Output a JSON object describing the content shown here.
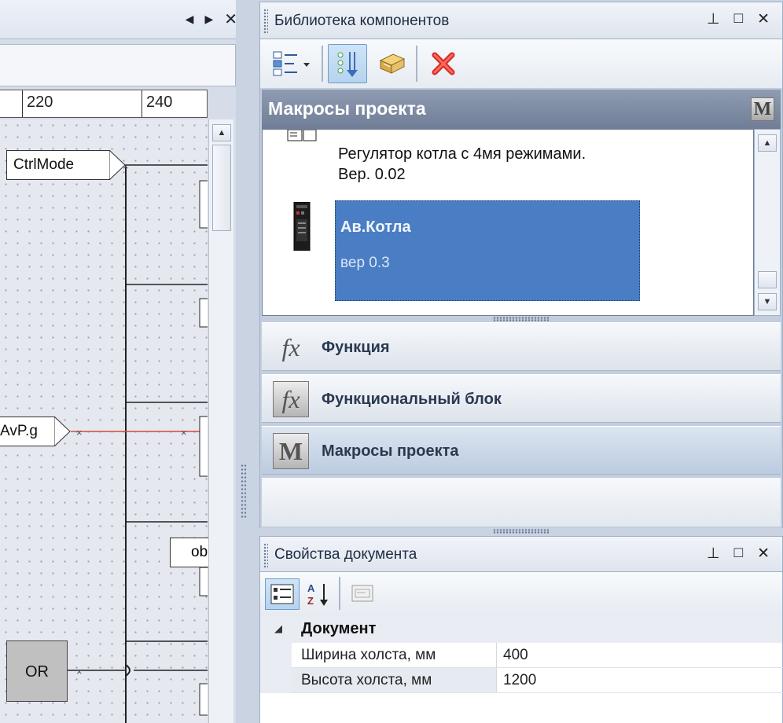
{
  "editor": {
    "tab_nav": {
      "prev": "◀",
      "next": "▶",
      "close": "✕"
    },
    "ruler": {
      "labels": [
        "220",
        "240"
      ]
    },
    "scroll_up": "▲",
    "labels": {
      "ctrl_mode": "CtrlMode",
      "avp": "AvP.g",
      "ob": "ob",
      "or_block": "OR"
    }
  },
  "library_panel": {
    "title": "Библиотека компонентов",
    "pin": "⊥",
    "maximize": "□",
    "close": "✕",
    "section_title": "Макросы проекта",
    "section_badge": "M",
    "items": [
      {
        "name": "Регулятор котла с 4мя режимами.",
        "version": "Вер. 0.02"
      },
      {
        "name": "Ав.Котла",
        "version": "вер 0.3"
      }
    ],
    "scroll_up": "▲",
    "scroll_down": "▼",
    "categories": [
      {
        "icon": "fx",
        "label": "Функция"
      },
      {
        "icon": "fx",
        "label": "Функциональный блок"
      },
      {
        "icon": "M",
        "label": "Макросы проекта"
      }
    ]
  },
  "properties_panel": {
    "title": "Свойства документа",
    "pin": "⊥",
    "maximize": "□",
    "close": "✕",
    "sort_label": "A Z",
    "category": "Документ",
    "expand_glyph": "◢",
    "rows": [
      {
        "name": "Ширина холста, мм",
        "value": "400"
      },
      {
        "name": "Высота холста, мм",
        "value": "1200"
      }
    ]
  }
}
